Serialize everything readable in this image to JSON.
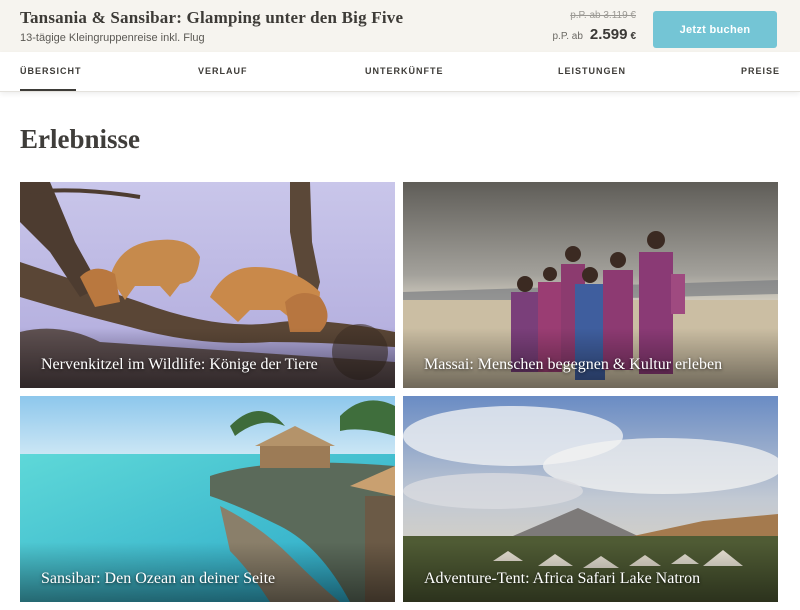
{
  "header": {
    "title": "Tansania & Sansibar: Glamping unter den Big Five",
    "subtitle": "13-tägige Kleingruppenreise inkl. Flug",
    "price_old": "p.P. ab 3.119 €",
    "price_prefix": "p.P. ab",
    "price_value": "2.599",
    "price_currency": "€",
    "book_label": "Jetzt buchen"
  },
  "tabs": [
    {
      "label": "ÜBERSICHT",
      "active": true
    },
    {
      "label": "VERLAUF",
      "active": false
    },
    {
      "label": "UNTERKÜNFTE",
      "active": false
    },
    {
      "label": "LEISTUNGEN",
      "active": false
    },
    {
      "label": "PREISE",
      "active": false
    }
  ],
  "section": {
    "title": "Erlebnisse"
  },
  "experiences": [
    {
      "caption": "Nervenkitzel im Wildlife: Könige der Tiere",
      "icon": "lions-in-tree-image"
    },
    {
      "caption": "Massai: Menschen begegnen & Kultur erleben",
      "icon": "maasai-people-image"
    },
    {
      "caption": "Sansibar: Den Ozean an deiner Seite",
      "icon": "zanzibar-beach-image"
    },
    {
      "caption": "Adventure-Tent: Africa Safari Lake Natron",
      "icon": "safari-tent-camp-image"
    }
  ],
  "colors": {
    "accent": "#74c5d5",
    "topbar_bg": "#f6f4ef",
    "text": "#3d3b37"
  }
}
